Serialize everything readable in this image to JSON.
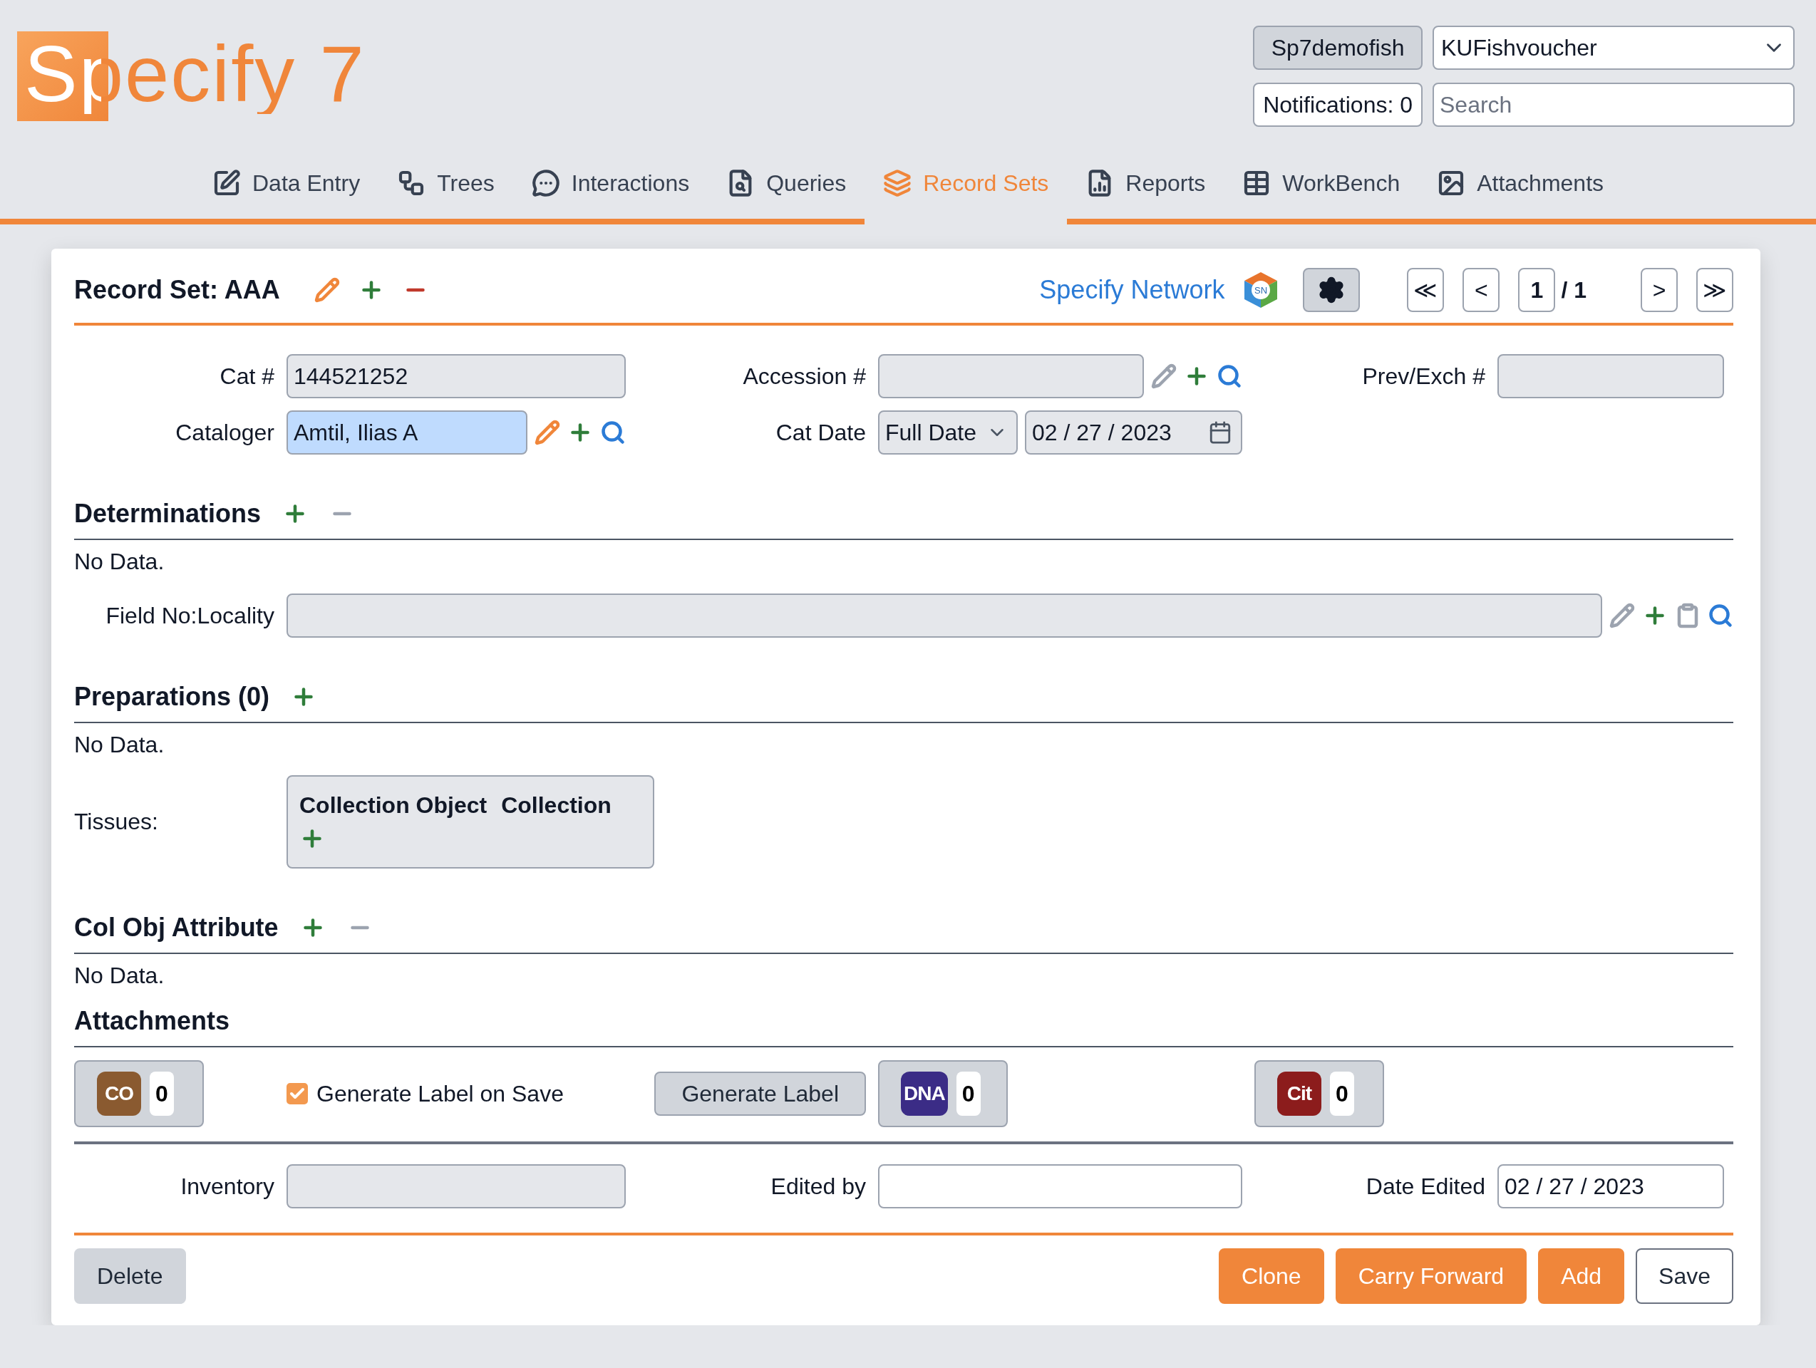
{
  "header": {
    "logo": {
      "text": "Specify 7"
    },
    "user_button": "Sp7demofish",
    "collection_select": {
      "value": "KUFishvoucher"
    },
    "notifications_button": "Notifications: 0",
    "search": {
      "placeholder": "Search"
    }
  },
  "nav_tabs": [
    {
      "label": "Data Entry",
      "kind": "dataentry",
      "selected": false
    },
    {
      "label": "Trees",
      "kind": "trees",
      "selected": false
    },
    {
      "label": "Interactions",
      "kind": "interactions",
      "selected": false
    },
    {
      "label": "Queries",
      "kind": "queries",
      "selected": false
    },
    {
      "label": "Record Sets",
      "kind": "recordsets",
      "selected": true
    },
    {
      "label": "Reports",
      "kind": "reports",
      "selected": false
    },
    {
      "label": "WorkBench",
      "kind": "workbench",
      "selected": false
    },
    {
      "label": "Attachments",
      "kind": "attachments",
      "selected": false
    }
  ],
  "record_set": {
    "title": "Record Set: AAA",
    "actions": [
      {
        "kind": "edit",
        "disabled": false
      },
      {
        "kind": "add",
        "disabled": false
      },
      {
        "kind": "delete",
        "disabled": false
      }
    ],
    "network_link": "Specify Network",
    "network_logo": "SN",
    "pager": {
      "first": "≪",
      "prev": "<",
      "current": "1",
      "total": "/ 1",
      "next": ">",
      "last": "≫"
    }
  },
  "blocks": [
    {
      "kind": "grid",
      "cells": [
        {
          "label": "Cat #",
          "kind": "text",
          "value": "144521252",
          "required": false,
          "readonly": false
        },
        {
          "label": "Accession #",
          "kind": "query",
          "required": false,
          "readonly": false,
          "actions": [
            {
              "kind": "edit",
              "disabled": true
            },
            {
              "kind": "add",
              "disabled": false
            },
            {
              "kind": "search",
              "disabled": false
            }
          ]
        },
        {
          "label": "Prev/Exch #",
          "kind": "text",
          "required": false,
          "readonly": false
        },
        {
          "label": "Cataloger",
          "kind": "query",
          "value": "Amtil, Ilias A",
          "required": true,
          "readonly": false,
          "actions": [
            {
              "kind": "edit",
              "disabled": false
            },
            {
              "kind": "add",
              "disabled": false
            },
            {
              "kind": "search",
              "disabled": false
            }
          ]
        },
        {
          "label": "Cat Date",
          "kind": "date",
          "precision": "Full Date",
          "value": "02 / 27 / 2023",
          "required": false,
          "readonly": false
        }
      ]
    },
    {
      "kind": "section",
      "title": "Determinations",
      "actions": [
        {
          "kind": "add",
          "disabled": false
        },
        {
          "kind": "remove",
          "disabled": true
        }
      ],
      "empty_text": "No Data."
    },
    {
      "kind": "wide",
      "field": {
        "label": "Field No:Locality",
        "kind": "query",
        "required": false,
        "readonly": false,
        "actions": [
          {
            "kind": "edit",
            "disabled": true
          },
          {
            "kind": "add",
            "disabled": false
          },
          {
            "kind": "clone",
            "disabled": true
          },
          {
            "kind": "search",
            "disabled": false
          }
        ]
      }
    },
    {
      "kind": "section",
      "title": "Preparations (0)",
      "actions": [
        {
          "kind": "add",
          "disabled": false
        }
      ],
      "empty_text": "No Data."
    },
    {
      "kind": "subview",
      "label": "Tissues:",
      "columns": [
        "Collection Object",
        "Collection"
      ]
    },
    {
      "kind": "section",
      "title": "Col Obj Attribute",
      "actions": [
        {
          "kind": "add",
          "disabled": false
        },
        {
          "kind": "remove",
          "disabled": true
        }
      ],
      "empty_text": "No Data."
    },
    {
      "kind": "section",
      "title": "Attachments"
    },
    {
      "kind": "toolbar",
      "items": [
        {
          "kind": "badge",
          "text": "CO",
          "count": "0",
          "color": "#8a5a30"
        },
        {
          "kind": "checkbox",
          "label": "Generate Label on Save",
          "checked": true
        },
        {
          "kind": "button",
          "label": "Generate Label"
        },
        {
          "kind": "badge",
          "text": "DNA",
          "count": "0",
          "color": "#3b2c86"
        },
        {
          "kind": "badge",
          "text": "Cit",
          "count": "0",
          "color": "#8c1c1c"
        }
      ]
    },
    {
      "kind": "grid",
      "cells": [
        {
          "label": "Inventory",
          "kind": "text",
          "required": false,
          "readonly": false
        },
        {
          "label": "Edited by",
          "kind": "text",
          "required": false,
          "readonly": true
        },
        {
          "label": "Date Edited",
          "kind": "text",
          "value": "02 / 27 / 2023",
          "required": false,
          "readonly": true
        }
      ]
    }
  ],
  "footer": {
    "buttons": [
      {
        "label": "Delete",
        "kind": "secondary"
      },
      {
        "label": "Clone",
        "kind": "primary"
      },
      {
        "label": "Carry Forward",
        "kind": "primary"
      },
      {
        "label": "Add",
        "kind": "primary"
      },
      {
        "label": "Save",
        "kind": "outline"
      }
    ]
  }
}
